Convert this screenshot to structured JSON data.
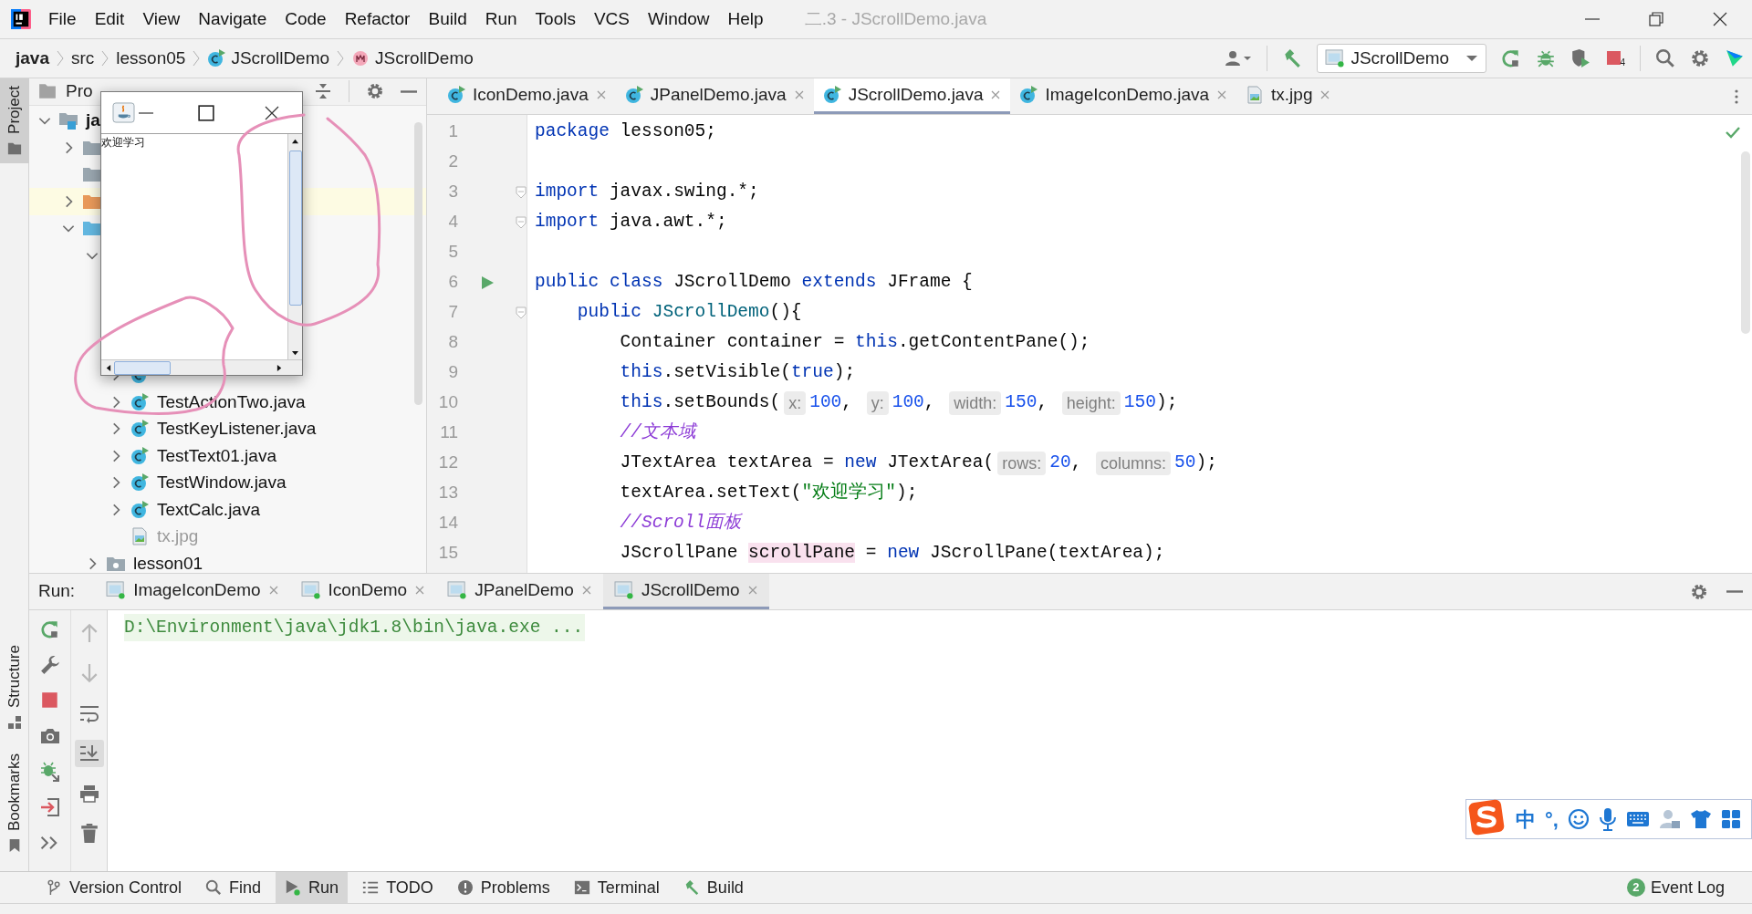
{
  "window": {
    "title": "二.3 - JScrollDemo.java"
  },
  "menu": [
    "File",
    "Edit",
    "View",
    "Navigate",
    "Code",
    "Refactor",
    "Build",
    "Run",
    "Tools",
    "VCS",
    "Window",
    "Help"
  ],
  "breadcrumbs": [
    {
      "label": "java",
      "kind": "root"
    },
    {
      "label": "src",
      "kind": "folder"
    },
    {
      "label": "lesson05",
      "kind": "folder"
    },
    {
      "label": "JScrollDemo",
      "kind": "class"
    },
    {
      "label": "JScrollDemo",
      "kind": "method"
    }
  ],
  "run_config": {
    "label": "JScrollDemo",
    "stop_count": "4"
  },
  "left_stripe": [
    {
      "label": "Project",
      "selected": true
    },
    {
      "label": "Structure",
      "selected": false
    },
    {
      "label": "Bookmarks",
      "selected": false
    }
  ],
  "project_panel": {
    "title": "Pro",
    "tree": [
      {
        "label": "ja",
        "kind": "module",
        "expanded": true,
        "children": [
          {
            "kind": "folder",
            "expanded": false,
            "highlighted": false
          },
          {
            "kind": "folder",
            "highlighted": false
          },
          {
            "kind": "excluded",
            "expanded": false,
            "highlighted": true
          },
          {
            "kind": "source",
            "expanded": true,
            "highlighted": false,
            "children": [
              {
                "expanded": true,
                "children": [
                  {
                    "kind": "class",
                    "expanded": false
                  },
                  {
                    "label": "TestActionTwo.java",
                    "kind": "class",
                    "expanded": false
                  },
                  {
                    "label": "TestKeyListener.java",
                    "kind": "class",
                    "expanded": false
                  },
                  {
                    "label": "TestText01.java",
                    "kind": "class",
                    "expanded": false
                  },
                  {
                    "label": "TestWindow.java",
                    "kind": "class",
                    "expanded": false
                  },
                  {
                    "label": "TextCalc.java",
                    "kind": "class",
                    "expanded": false
                  },
                  {
                    "label": "tx.jpg",
                    "kind": "image"
                  }
                ]
              },
              {
                "label": "lesson01",
                "kind": "package",
                "expanded": false
              }
            ]
          }
        ]
      }
    ]
  },
  "editor": {
    "tabs": [
      {
        "label": "IconDemo.java",
        "kind": "class",
        "selected": false
      },
      {
        "label": "JPanelDemo.java",
        "kind": "class",
        "selected": false
      },
      {
        "label": "JScrollDemo.java",
        "kind": "class",
        "selected": true
      },
      {
        "label": "ImageIconDemo.java",
        "kind": "class",
        "selected": false
      },
      {
        "label": "tx.jpg",
        "kind": "image",
        "selected": false
      }
    ],
    "lines": [
      {
        "number": "1",
        "tokens": [
          {
            "kind": "keyword",
            "text": "package"
          },
          {
            "kind": "plain",
            "text": " lesson05;"
          }
        ]
      },
      {
        "number": "2"
      },
      {
        "number": "3",
        "fold": true,
        "tokens": [
          {
            "kind": "keyword",
            "text": "import"
          },
          {
            "kind": "plain",
            "text": " javax.swing.*;"
          }
        ]
      },
      {
        "number": "4",
        "fold": true,
        "tokens": [
          {
            "kind": "keyword",
            "text": "import"
          },
          {
            "kind": "plain",
            "text": " java.awt.*;"
          }
        ]
      },
      {
        "number": "5"
      },
      {
        "number": "6",
        "run": true,
        "tokens": [
          {
            "kind": "keyword",
            "text": "public class"
          },
          {
            "kind": "plain",
            "text": " JScrollDemo "
          },
          {
            "kind": "keyword",
            "text": "extends"
          },
          {
            "kind": "plain",
            "text": " JFrame {"
          }
        ]
      },
      {
        "number": "7",
        "fold": true,
        "tokens": [
          {
            "kind": "keyword",
            "text": "    public"
          },
          {
            "kind": "declaration",
            "text": " JScrollDemo"
          },
          {
            "kind": "plain",
            "text": "(){"
          }
        ]
      },
      {
        "number": "8",
        "tokens": [
          {
            "kind": "plain",
            "text": "        Container container = "
          },
          {
            "kind": "keyword",
            "text": "this"
          },
          {
            "kind": "plain",
            "text": ".getContentPane();"
          }
        ]
      },
      {
        "number": "9",
        "tokens": [
          {
            "kind": "keyword",
            "text": "        this"
          },
          {
            "kind": "plain",
            "text": ".setVisible("
          },
          {
            "kind": "keyword",
            "text": "true"
          },
          {
            "kind": "plain",
            "text": ");"
          }
        ]
      },
      {
        "number": "10",
        "tokens": [
          {
            "kind": "keyword",
            "text": "        this"
          },
          {
            "kind": "plain",
            "text": ".setBounds("
          },
          {
            "kind": "hint",
            "text": "x:"
          },
          {
            "kind": "number",
            "text": "100"
          },
          {
            "kind": "plain",
            "text": ", "
          },
          {
            "kind": "hint",
            "text": "y:"
          },
          {
            "kind": "number",
            "text": "100"
          },
          {
            "kind": "plain",
            "text": ", "
          },
          {
            "kind": "hint",
            "text": "width:"
          },
          {
            "kind": "number",
            "text": "150"
          },
          {
            "kind": "plain",
            "text": ", "
          },
          {
            "kind": "hint",
            "text": "height:"
          },
          {
            "kind": "number",
            "text": "150"
          },
          {
            "kind": "plain",
            "text": ");"
          }
        ]
      },
      {
        "number": "11",
        "tokens": [
          {
            "kind": "comment",
            "text": "        //文本域"
          }
        ]
      },
      {
        "number": "12",
        "tokens": [
          {
            "kind": "plain",
            "text": "        JTextArea textArea = "
          },
          {
            "kind": "keyword",
            "text": "new"
          },
          {
            "kind": "plain",
            "text": " JTextArea("
          },
          {
            "kind": "hint",
            "text": "rows:"
          },
          {
            "kind": "number",
            "text": "20"
          },
          {
            "kind": "plain",
            "text": ", "
          },
          {
            "kind": "hint",
            "text": "columns:"
          },
          {
            "kind": "number",
            "text": "50"
          },
          {
            "kind": "plain",
            "text": ");"
          }
        ]
      },
      {
        "number": "13",
        "tokens": [
          {
            "kind": "plain",
            "text": "        textArea.setText("
          },
          {
            "kind": "string",
            "text": "\"欢迎学习\""
          },
          {
            "kind": "plain",
            "text": ");"
          }
        ]
      },
      {
        "number": "14",
        "tokens": [
          {
            "kind": "comment",
            "text": "        //Scroll面板"
          }
        ]
      },
      {
        "number": "15",
        "tokens": [
          {
            "kind": "plain",
            "text": "        JScrollPane "
          },
          {
            "kind": "highlight",
            "text": "scrollPane"
          },
          {
            "kind": "plain",
            "text": " = "
          },
          {
            "kind": "keyword",
            "text": "new"
          },
          {
            "kind": "plain",
            "text": " JScrollPane(textArea);"
          }
        ]
      }
    ]
  },
  "swing_window": {
    "text": "欢迎学习"
  },
  "run_panel": {
    "label": "Run:",
    "tabs": [
      {
        "label": "ImageIconDemo",
        "selected": false
      },
      {
        "label": "IconDemo",
        "selected": false
      },
      {
        "label": "JPanelDemo",
        "selected": false
      },
      {
        "label": "JScrollDemo",
        "selected": true
      }
    ],
    "console": [
      "D:\\Environment\\java\\jdk1.8\\bin\\java.exe ..."
    ]
  },
  "ime_bar": {
    "items": [
      "中",
      "°,"
    ]
  },
  "tool_windows": [
    {
      "label": "Version Control",
      "kind": "branch",
      "selected": false
    },
    {
      "label": "Find",
      "kind": "search",
      "selected": false
    },
    {
      "label": "Run",
      "kind": "play",
      "selected": true
    },
    {
      "label": "TODO",
      "kind": "list",
      "selected": false
    },
    {
      "label": "Problems",
      "kind": "problem",
      "selected": false
    },
    {
      "label": "Terminal",
      "kind": "terminal",
      "selected": false
    },
    {
      "label": "Build",
      "kind": "hammer",
      "selected": false
    }
  ],
  "event_log": {
    "label": "Event Log",
    "count": "2"
  }
}
